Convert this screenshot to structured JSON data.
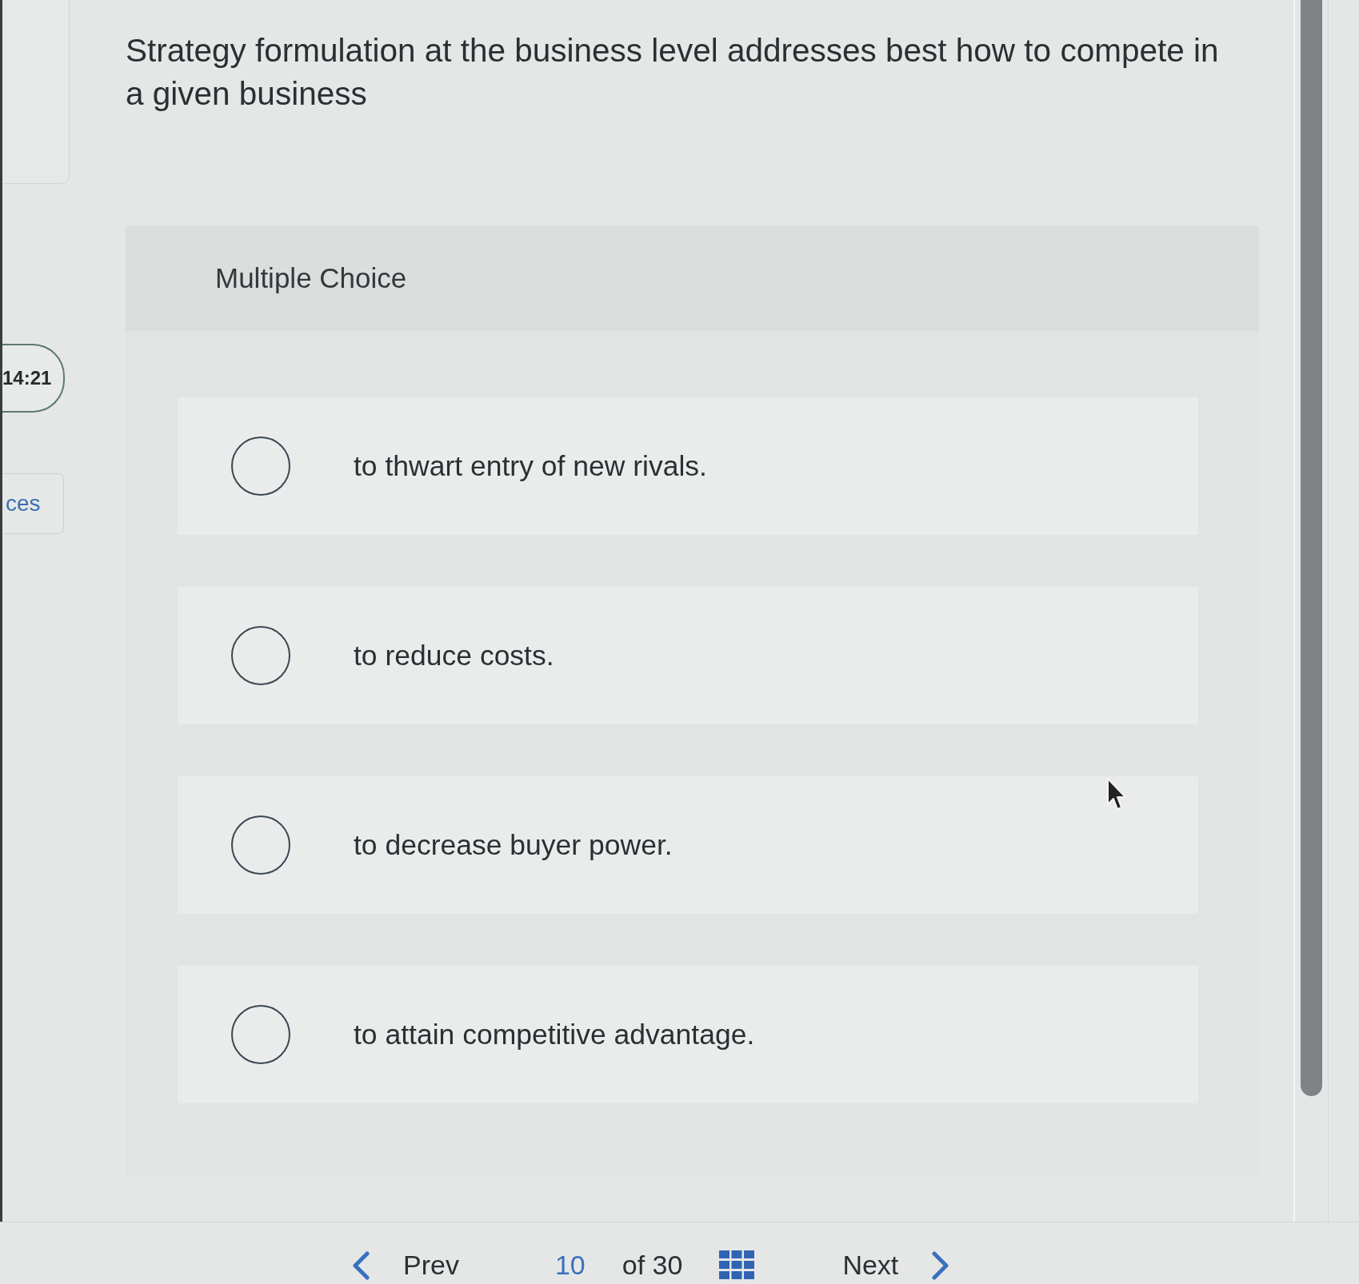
{
  "sidebar": {
    "timer": "14:21",
    "button": "ces"
  },
  "question": {
    "prompt": "Strategy formulation at the business level addresses best how to compete in a given business",
    "type_label": "Multiple Choice",
    "options": [
      {
        "label": "to thwart entry of new rivals.",
        "selected": false
      },
      {
        "label": "to reduce costs.",
        "selected": false
      },
      {
        "label": "to decrease buyer power.",
        "selected": false
      },
      {
        "label": "to attain competitive advantage.",
        "selected": false
      }
    ]
  },
  "navigation": {
    "prev": "Prev",
    "current_page": "10",
    "page_total": "of 30",
    "next": "Next"
  }
}
